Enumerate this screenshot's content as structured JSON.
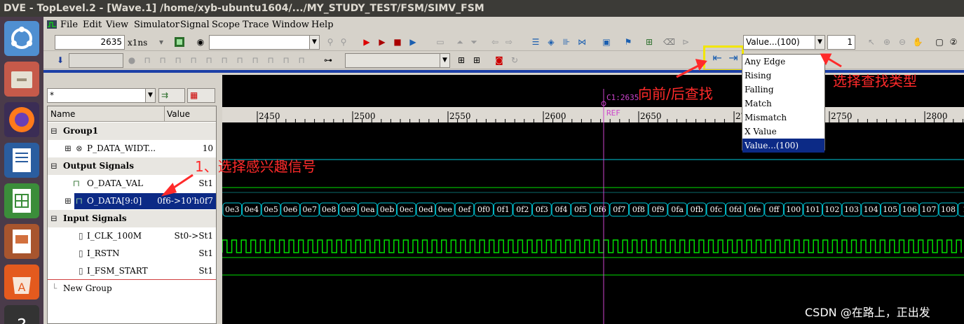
{
  "window": {
    "title": "DVE - TopLevel.2 - [Wave.1]  /home/xyb-ubuntu1604/.../MY_STUDY_TEST/FSM/SIMV_FSM"
  },
  "menu": [
    "File",
    "Edit",
    "View",
    "Simulator",
    "Signal",
    "Scope",
    "Trace",
    "Window",
    "Help"
  ],
  "toolbar": {
    "time_value": "2635",
    "time_unit": "x1ns",
    "search_type": "Value...(100)",
    "search_count": "1"
  },
  "signal_pane": {
    "filter": "*",
    "col_name": "Name",
    "col_value": "Value",
    "rows": [
      {
        "name": "Group1",
        "value": "",
        "kind": "group"
      },
      {
        "name": "P_DATA_WIDT...",
        "value": "10",
        "kind": "param"
      },
      {
        "name": "Output Signals",
        "value": "",
        "kind": "group"
      },
      {
        "name": "O_DATA_VAL",
        "value": "St1",
        "kind": "bit"
      },
      {
        "name": "O_DATA[9:0]",
        "value": "0f6->10'h0f7",
        "kind": "bus",
        "selected": true
      },
      {
        "name": "Input Signals",
        "value": "",
        "kind": "group"
      },
      {
        "name": "I_CLK_100M",
        "value": "St0->St1",
        "kind": "in"
      },
      {
        "name": "I_RSTN",
        "value": "St1",
        "kind": "in"
      },
      {
        "name": "I_FSM_START",
        "value": "St1",
        "kind": "in"
      },
      {
        "name": "New Group",
        "value": "",
        "kind": "new"
      }
    ]
  },
  "wave": {
    "cursor_label": "C1:2635",
    "ref_label": "REF",
    "ruler_ticks": [
      "2450",
      "2500",
      "2550",
      "2600",
      "2650",
      "2700",
      "2750",
      "2800"
    ],
    "bus_values": [
      "0e3",
      "0e4",
      "0e5",
      "0e6",
      "0e7",
      "0e8",
      "0e9",
      "0ea",
      "0eb",
      "0ec",
      "0ed",
      "0ee",
      "0ef",
      "0f0",
      "0f1",
      "0f2",
      "0f3",
      "0f4",
      "0f5",
      "0f6",
      "0f7",
      "0f8",
      "0f9",
      "0fa",
      "0fb",
      "0fc",
      "0fd",
      "0fe",
      "0ff",
      "100",
      "101",
      "102",
      "103",
      "104",
      "105",
      "106",
      "107",
      "108",
      "10"
    ]
  },
  "search_dropdown": [
    "Any Edge",
    "Rising",
    "Falling",
    "Match",
    "Mismatch",
    "X Value",
    "Value...(100)"
  ],
  "annotations": {
    "select_signal": "1、选择感兴趣信号",
    "search_direction": "向前/后查找",
    "search_type": "选择查找类型"
  },
  "watermark": "CSDN @在路上，正出发",
  "colors": {
    "wave_green": "#00e000",
    "wave_cyan": "#00c8d8",
    "cursor": "#cc44cc",
    "annot": "#ff2a2a"
  }
}
